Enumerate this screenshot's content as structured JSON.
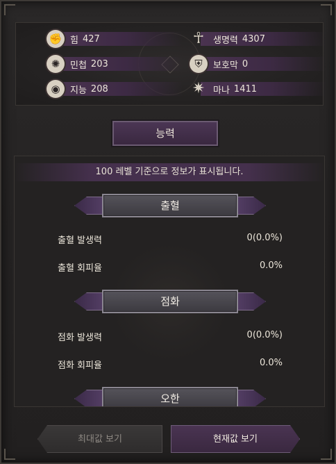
{
  "stats": [
    {
      "icon": "fist-icon",
      "glyph": "✊",
      "label": "힘",
      "value": "427"
    },
    {
      "icon": "ankh-icon",
      "glyph": "☥",
      "label": "생명력",
      "value": "4307"
    },
    {
      "icon": "triskelion-icon",
      "glyph": "✺",
      "label": "민첩",
      "value": "203"
    },
    {
      "icon": "shield-icon",
      "glyph": "⛨",
      "label": "보호막",
      "value": "0"
    },
    {
      "icon": "eye-icon",
      "glyph": "◉",
      "label": "지능",
      "value": "208"
    },
    {
      "icon": "star-icon",
      "glyph": "✷",
      "label": "마나",
      "value": "1411"
    }
  ],
  "tab_label": "능력",
  "notice": "100 레벨 기준으로 정보가 표시됩니다.",
  "sections": [
    {
      "title": "출혈",
      "rows": [
        {
          "label": "출혈 발생력",
          "value": "0(0.0%)"
        },
        {
          "label": "출혈 회피율",
          "value": "0.0%"
        }
      ]
    },
    {
      "title": "점화",
      "rows": [
        {
          "label": "점화 발생력",
          "value": "0(0.0%)"
        },
        {
          "label": "점화 회피율",
          "value": "0.0%"
        }
      ]
    },
    {
      "title": "오한",
      "rows": []
    }
  ],
  "buttons": {
    "max_label": "최대값 보기",
    "current_label": "현재값 보기"
  },
  "colors": {
    "accent_purple": "#45304d",
    "panel_bg": "#242222",
    "text": "#ece6da"
  }
}
